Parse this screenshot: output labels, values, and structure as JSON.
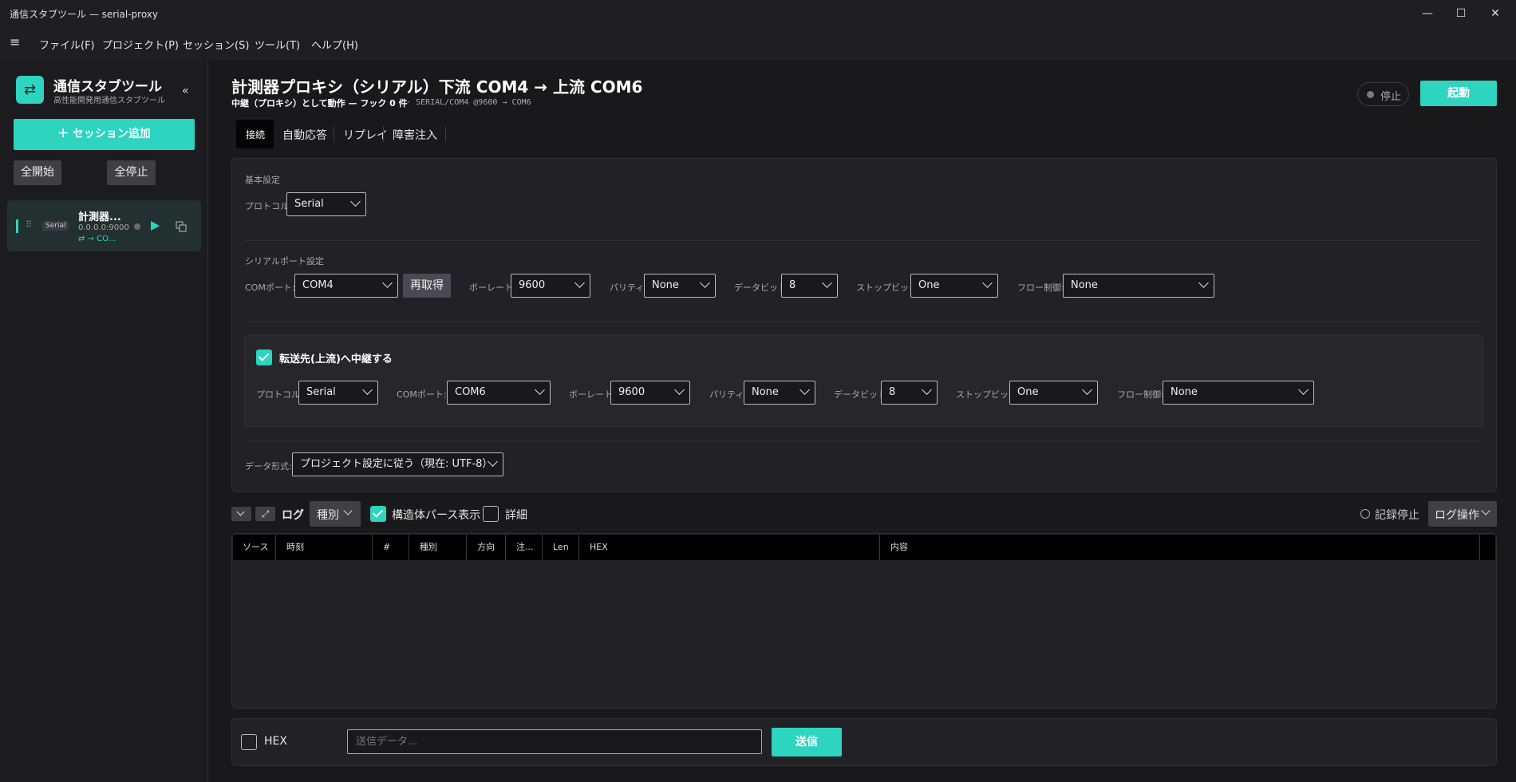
{
  "window": {
    "title": "通信スタブツール — serial-proxy",
    "min": "—",
    "max": "☐",
    "close": "✕"
  },
  "menu": {
    "hamburger": "≡",
    "items": [
      "ファイル(F)",
      "プロジェクト(P)",
      "セッション(S)",
      "ツール(T)",
      "ヘルプ(H)"
    ]
  },
  "sidebar": {
    "app_name": "通信スタブツール",
    "app_sub": "高性能開発用通信スタブツール",
    "collapse": "«",
    "logo_glyph": "⇄",
    "add_session": "＋ セッション追加",
    "start_all": "全開始",
    "stop_all": "全停止",
    "session": {
      "badge": "Serial",
      "name": "計測器...",
      "addr": "0.0.0.0:9000",
      "route": "⇄ → CO..."
    }
  },
  "header": {
    "title": "計測器プロキシ（シリアル）下流 COM4 → 上流 COM6",
    "sub_bold": "中継（プロキシ）として動作 — フック 0 件",
    "sub_mono": "· SERIAL/COM4 @9600 → COM6",
    "status": "停止",
    "start": "起動"
  },
  "tabs": [
    "接続",
    "自動応答",
    "リプレイ",
    "障害注入"
  ],
  "basic": {
    "section": "基本設定",
    "protocol_label": "プロトコル:",
    "protocol": "Serial"
  },
  "serial": {
    "section": "シリアルポート設定",
    "com_label": "COMポート:",
    "com": "COM4",
    "refresh": "再取得",
    "baud_label": "ボーレート:",
    "baud": "9600",
    "parity_label": "パリティ:",
    "parity": "None",
    "databits_label": "データビット:",
    "databits": "8",
    "stopbits_label": "ストップビット:",
    "stopbits": "One",
    "flow_label": "フロー制御:",
    "flow": "None"
  },
  "forward": {
    "label": "転送先(上流)へ中継する",
    "checked": true,
    "protocol_label": "プロトコル:",
    "protocol": "Serial",
    "com_label": "COMポート:",
    "com": "COM6",
    "baud_label": "ボーレート:",
    "baud": "9600",
    "parity_label": "パリティ:",
    "parity": "None",
    "databits_label": "データビット:",
    "databits": "8",
    "stopbits_label": "ストップビット:",
    "stopbits": "One",
    "flow_label": "フロー制御:",
    "flow": "None"
  },
  "format": {
    "label": "データ形式:",
    "value": "プロジェクト設定に従う（現在: UTF-8）"
  },
  "log": {
    "title": "ログ",
    "kind": "種別",
    "struct": "構造体パース表示",
    "detail": "詳細",
    "record_stop": "記録停止",
    "ops": "ログ操作",
    "columns": [
      "ソース",
      "時刻",
      "#",
      "種別",
      "方向",
      "注...",
      "Len",
      "HEX",
      "内容"
    ]
  },
  "send": {
    "hex": "HEX",
    "placeholder": "送信データ...",
    "button": "送信"
  },
  "colors": {
    "accent": "#2dd4bf",
    "bg": "#19191c",
    "panel": "#222226"
  }
}
